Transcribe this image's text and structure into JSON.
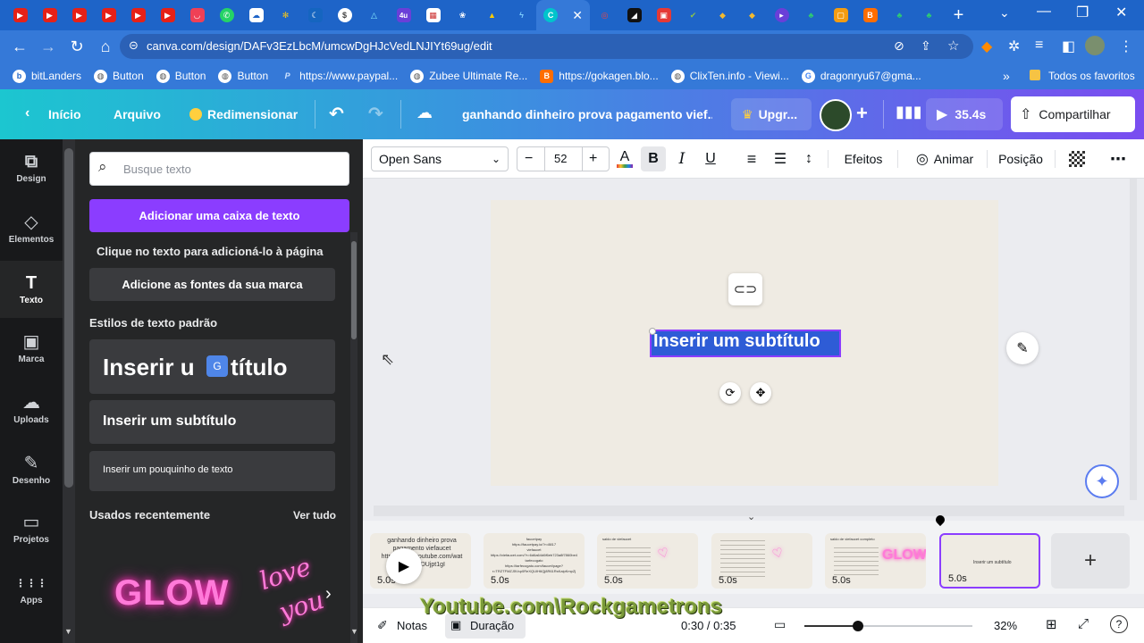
{
  "browser": {
    "url": "canva.com/design/DAFv3EzLbcM/umcwDgHJcVedLNJIYt69ug/edit",
    "bookmarks": [
      "bitLanders",
      "Button",
      "Button",
      "Button",
      "https://www.paypal...",
      "Zubee Ultimate Re...",
      "https://gokagen.blo...",
      "ClixTen.info - Viewi...",
      "dragonryu67@gma..."
    ],
    "all_bookmarks": "Todos os favoritos",
    "tab_labels": {
      "t12": "4u"
    }
  },
  "header": {
    "inicio": "Início",
    "arquivo": "Arquivo",
    "redimensionar": "Redimensionar",
    "title": "ganhando dinheiro prova pagamento viefaucet",
    "title_display": "ganhando dinheiro prova pagamento vief...",
    "upgrade": "Upgr...",
    "duration": "35.4s",
    "share": "Compartilhar"
  },
  "rail": [
    {
      "label": "Design",
      "icon": "⧉"
    },
    {
      "label": "Elementos",
      "icon": "◇"
    },
    {
      "label": "Texto",
      "icon": "T"
    },
    {
      "label": "Marca",
      "icon": "▣"
    },
    {
      "label": "Uploads",
      "icon": "☁"
    },
    {
      "label": "Desenho",
      "icon": "✎"
    },
    {
      "label": "Projetos",
      "icon": "▭"
    },
    {
      "label": "Apps",
      "icon": "⋮⋮⋮"
    }
  ],
  "panel": {
    "search_placeholder": "Busque texto",
    "add_text_box": "Adicionar uma caixa de texto",
    "click_hint": "Clique no texto para adicioná-lo à página",
    "brand_fonts": "Adicione as fontes da sua marca",
    "default_styles": "Estilos de texto padrão",
    "style_title": "Inserir um título",
    "style_title_a": "Inserir u",
    "style_title_b": "título",
    "style_subtitle": "Inserir um subtítulo",
    "style_body": "Inserir um pouquinho de texto",
    "recent": "Usados recentemente",
    "see_all": "Ver tudo",
    "recent_glow": "GLOW",
    "recent_love_a": "love",
    "recent_love_b": "you"
  },
  "toolbar": {
    "font": "Open Sans",
    "font_size": "52",
    "minus": "−",
    "plus": "+",
    "effects": "Efeitos",
    "animate": "Animar",
    "position": "Posição"
  },
  "canvas": {
    "selected_text": "Inserir um subtítulo",
    "bg_color": "#efebe3",
    "selection_color": "#2e5cd6"
  },
  "pages": [
    {
      "duration": "5.0s",
      "lines": [
        "ganhando dinheiro prova",
        "pagamento viefaucet",
        "https://www.youtube.com/wat",
        "ch?v=...DUjpt1gI"
      ]
    },
    {
      "duration": "5.0s",
      "lines": [
        "faucetpay",
        "https://faucetpay.io/?r=8817",
        "viefaucet",
        "https://viefaucet.com/?r=6d6a64d6f6eb723a8f7860be4",
        "tarfecogato",
        "https://tarfecogato.com/faucet/page?",
        "r=TRZTFMZJ5Vcp0ReXQUIH6Qj8R61RsKaipKmpZj"
      ]
    },
    {
      "duration": "5.0s",
      "lines": [
        "saldo de viefaucet",
        "viefaucet",
        "",
        "",
        "",
        "",
        ""
      ],
      "kind": "love"
    },
    {
      "duration": "5.0s",
      "lines": [
        "viefaucet",
        "",
        "",
        "",
        "",
        ""
      ],
      "kind": "love"
    },
    {
      "duration": "5.0s",
      "lines": [
        "saldo de viefaucet completo"
      ],
      "kind": "glow",
      "glow": "GLOW"
    },
    {
      "duration": "5.0s",
      "lines": [
        "Inserir um subtítulo"
      ],
      "kind": "current"
    }
  ],
  "footer": {
    "notes": "Notas",
    "duration": "Duração",
    "time": "0:30 / 0:35",
    "zoom": "32%",
    "zoom_level": 0.32
  },
  "watermark": "Youtube.com\\Rockgametrons"
}
